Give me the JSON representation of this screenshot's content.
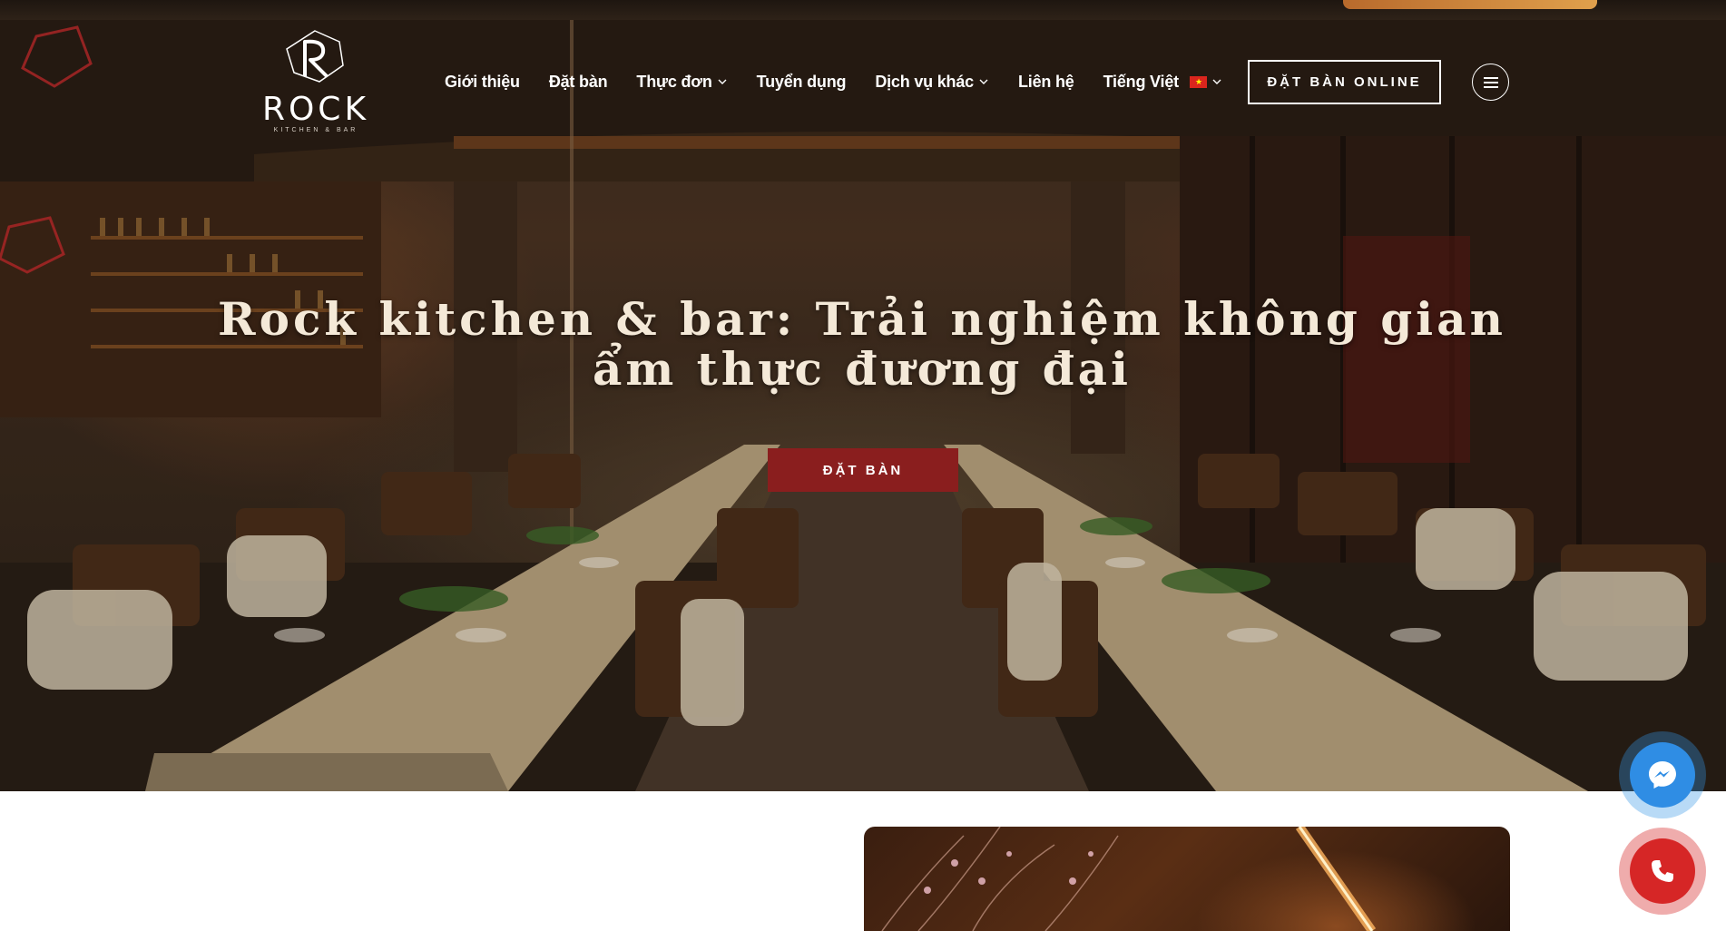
{
  "header": {
    "logo_word": "ROCK",
    "logo_sub": "KITCHEN & BAR",
    "nav": [
      {
        "label": "Giới thiệu",
        "dropdown": false
      },
      {
        "label": "Đặt bàn",
        "dropdown": false
      },
      {
        "label": "Thực đơn",
        "dropdown": true
      },
      {
        "label": "Tuyển dụng",
        "dropdown": false
      },
      {
        "label": "Dịch vụ khác",
        "dropdown": true
      },
      {
        "label": "Liên hệ",
        "dropdown": false
      },
      {
        "label": "Tiếng Việt",
        "dropdown": true,
        "flag": "vietnam-flag-icon"
      }
    ],
    "cta_online": "ĐẶT BÀN ONLINE",
    "menu_icon": "hamburger-menu-icon"
  },
  "hero": {
    "title": "Rock kitchen & bar: Trải nghiệm không gian ẩm thực đương đại",
    "cta": "ĐẶT BÀN"
  },
  "floating": {
    "messenger_icon": "messenger-icon",
    "phone_icon": "phone-icon"
  },
  "colors": {
    "accent_red": "#8a1e1e",
    "messenger_blue": "#2f8de4",
    "call_red": "#d62626",
    "hero_text": "#f4e9d8"
  }
}
